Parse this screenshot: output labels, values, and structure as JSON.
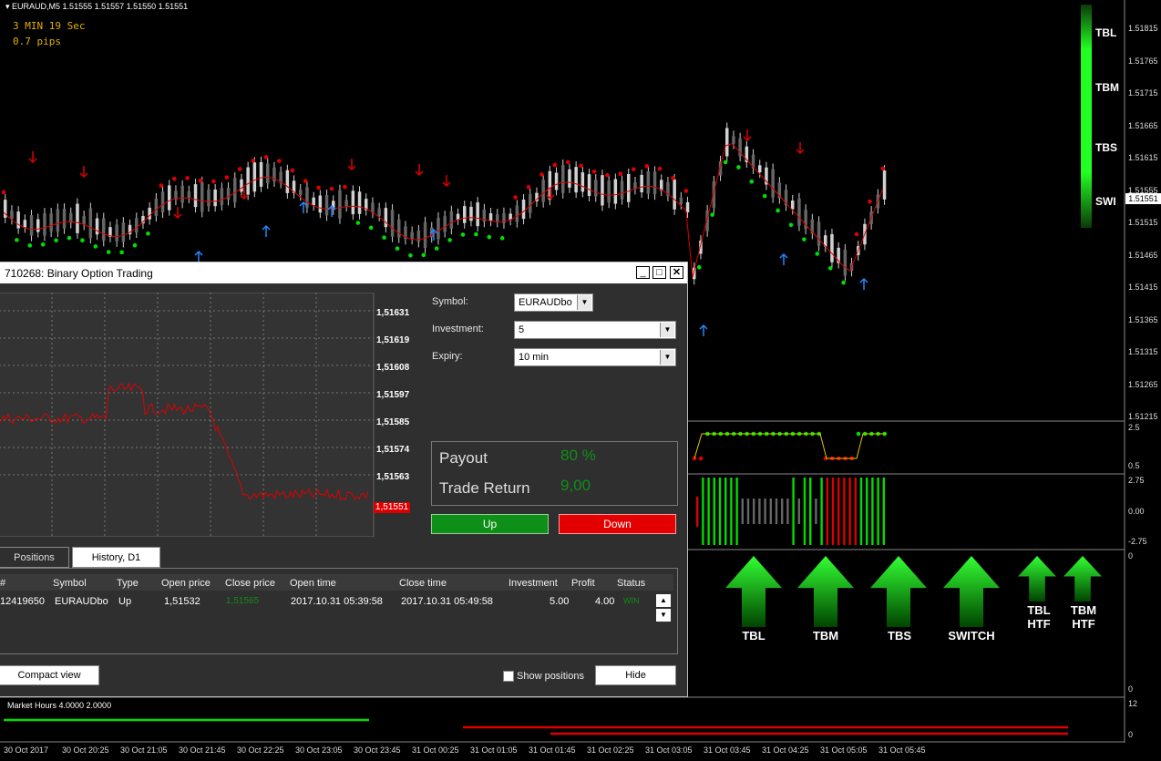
{
  "chart": {
    "symbol_header": "EURAUD,M5  1.51555 1.51557 1.51550 1.51551",
    "timer_line1": "3 MIN 19 Sec",
    "timer_line2": "0.7 pips",
    "price_axis": [
      "1.51815",
      "1.51765",
      "1.51715",
      "1.51665",
      "1.51615",
      "1.51555",
      "1.51515",
      "1.51465",
      "1.51415",
      "1.51365",
      "1.51315",
      "1.51265",
      "1.51215"
    ],
    "current_price": "1.51551",
    "trend_labels": [
      "TBL",
      "TBM",
      "TBS",
      "SWI"
    ],
    "sub1_axis": [
      "2.5",
      "0.5"
    ],
    "sub2_axis": [
      "2.75",
      "0.00",
      "-2.75"
    ],
    "sub3_axis": [
      "0",
      "0"
    ],
    "sub4_axis": [
      "12",
      "0"
    ],
    "market_hours": "Market Hours 4.0000 2.0000",
    "time_axis": [
      "30 Oct 2017",
      "30 Oct 20:25",
      "30 Oct 21:05",
      "30 Oct 21:45",
      "30 Oct 22:25",
      "30 Oct 23:05",
      "30 Oct 23:45",
      "31 Oct 00:25",
      "31 Oct 01:05",
      "31 Oct 01:45",
      "31 Oct 02:25",
      "31 Oct 03:05",
      "31 Oct 03:45",
      "31 Oct 04:25",
      "31 Oct 05:05",
      "31 Oct 05:45"
    ],
    "arrow_labels": [
      [
        "TBL"
      ],
      [
        "TBM"
      ],
      [
        "TBS"
      ],
      [
        "SWITCH"
      ],
      [
        "TBL",
        "HTF"
      ],
      [
        "TBM",
        "HTF"
      ]
    ],
    "colors": {
      "bull": "#00dd00",
      "bear": "#dd0000",
      "up_arrow": "#2288ff",
      "candle": "#d0d0d0"
    }
  },
  "dialog": {
    "title": "710268: Binary Option Trading",
    "mini_axis": [
      "1,51631",
      "1,51619",
      "1,51608",
      "1,51597",
      "1,51585",
      "1,51574",
      "1,51563"
    ],
    "mini_current": "1,51551",
    "symbol_label": "Symbol:",
    "symbol_value": "EURAUDbo",
    "investment_label": "Investment:",
    "investment_value": "5",
    "expiry_label": "Expiry:",
    "expiry_value": "10 min",
    "payout_label": "Payout",
    "payout_value": "80 %",
    "trade_return_label": "Trade Return",
    "trade_return_value": "9,00",
    "up_label": "Up",
    "down_label": "Down",
    "tabs": [
      "Positions",
      "History, D1"
    ],
    "columns": [
      "#",
      "Symbol",
      "Type",
      "Open price",
      "Close price",
      "Open time",
      "Close time",
      "Investment",
      "Profit",
      "Status"
    ],
    "row": [
      "12419650",
      "EURAUDbo",
      "Up",
      "1,51532",
      "1,51565",
      "2017.10.31 05:39:58",
      "2017.10.31 05:49:58",
      "5.00",
      "4.00",
      "WIN"
    ],
    "compact_view": "Compact view",
    "show_positions": "Show positions",
    "hide": "Hide"
  }
}
